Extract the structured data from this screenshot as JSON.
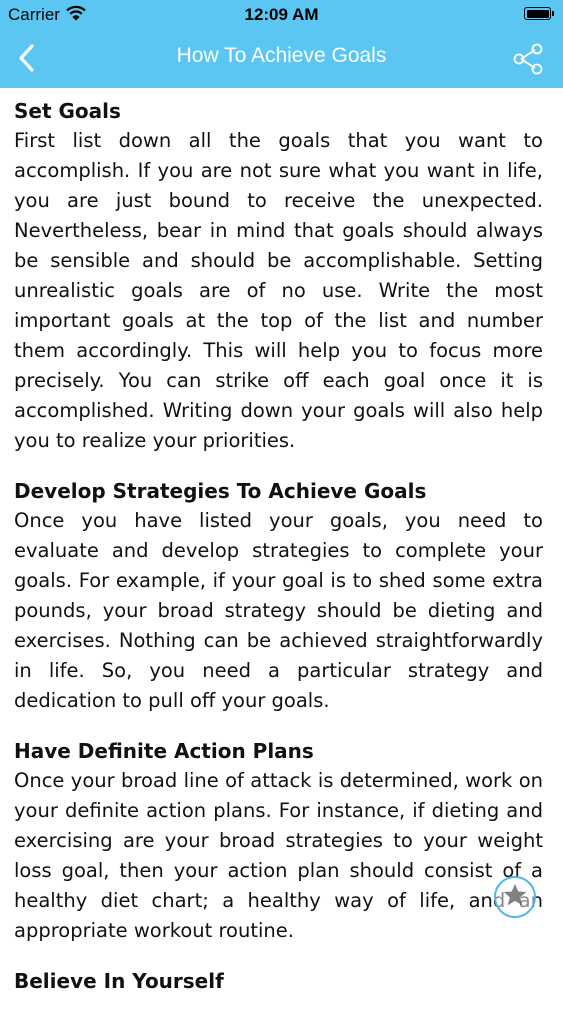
{
  "status_bar": {
    "carrier": "Carrier",
    "time": "12:09 AM",
    "battery_level": 1.0
  },
  "nav": {
    "title": "How To Achieve Goals",
    "back_icon": "chevron-left-icon",
    "share_icon": "share-icon"
  },
  "colors": {
    "nav_background": "#5bc6f2",
    "accent": "#4fb6e6",
    "text": "#111111"
  },
  "sections": [
    {
      "heading": "Set Goals",
      "body": "First list down all the goals that you want to accomplish. If you are not sure what you want in life, you are just bound to receive the unexpected. Nevertheless, bear in mind that goals should always be sensible and should be accomplishable. Setting unrealistic goals are of no use. Write the most important goals at the top of the list and number them accordingly. This will help you to focus more precisely. You can strike off each goal once it is accomplished. Writing down your goals will also help you to realize your priorities."
    },
    {
      "heading": "Develop Strategies To Achieve Goals",
      "body": "Once you have listed your goals, you need to evaluate and develop strategies to complete your goals. For example, if your goal is to shed some extra pounds, your broad strategy should be dieting and exercises. Nothing can be achieved straightforwardly in life. So, you need a particular strategy and dedication to pull off your goals."
    },
    {
      "heading": "Have Definite Action Plans",
      "body": "Once your broad line of attack is determined, work on your definite action plans. For instance, if dieting and exercising are your broad strategies to your weight loss goal, then your action plan should consist of a healthy diet chart; a healthy way of life, and an appropriate workout routine."
    },
    {
      "heading": "Believe In Yourself",
      "body": ""
    }
  ],
  "favorite_icon": "star-icon"
}
